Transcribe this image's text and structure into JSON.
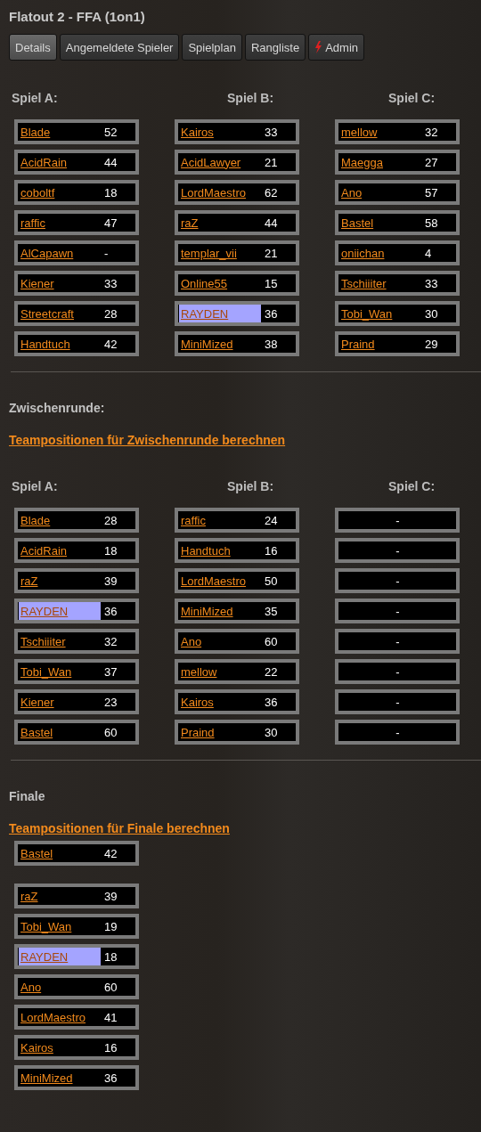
{
  "title": "Flatout 2 - FFA (1on1)",
  "tabs": [
    {
      "label": "Details",
      "selected": true,
      "kind": "plain"
    },
    {
      "label": "Angemeldete Spieler",
      "selected": false,
      "kind": "plain"
    },
    {
      "label": "Spielplan",
      "selected": false,
      "kind": "plain"
    },
    {
      "label": "Rangliste",
      "selected": false,
      "kind": "plain"
    },
    {
      "label": "Admin",
      "selected": false,
      "kind": "admin"
    }
  ],
  "rounds": [
    {
      "games": [
        {
          "heading": "Spiel A:",
          "players": [
            {
              "name": "Blade",
              "score": "52",
              "highlighted": false
            },
            {
              "name": "AcidRain",
              "score": "44",
              "highlighted": false
            },
            {
              "name": "coboltf",
              "score": "18",
              "highlighted": false
            },
            {
              "name": "raffic",
              "score": "47",
              "highlighted": false
            },
            {
              "name": "AlCapawn",
              "score": "-",
              "highlighted": false
            },
            {
              "name": "Kiener",
              "score": "33",
              "highlighted": false
            },
            {
              "name": "Streetcraft",
              "score": "28",
              "highlighted": false
            },
            {
              "name": "Handtuch",
              "score": "42",
              "highlighted": false
            }
          ]
        },
        {
          "heading": "Spiel B:",
          "players": [
            {
              "name": "Kairos",
              "score": "33",
              "highlighted": false
            },
            {
              "name": "AcidLawyer",
              "score": "21",
              "highlighted": false
            },
            {
              "name": "LordMaestro",
              "score": "62",
              "highlighted": false
            },
            {
              "name": "raZ",
              "score": "44",
              "highlighted": false
            },
            {
              "name": "templar_vii",
              "score": "21",
              "highlighted": false
            },
            {
              "name": "Online55",
              "score": "15",
              "highlighted": false
            },
            {
              "name": "RAYDEN",
              "score": "36",
              "highlighted": true
            },
            {
              "name": "MiniMized",
              "score": "38",
              "highlighted": false
            }
          ]
        },
        {
          "heading": "Spiel C:",
          "players": [
            {
              "name": "mellow",
              "score": "32",
              "highlighted": false
            },
            {
              "name": "Maegga",
              "score": "27",
              "highlighted": false
            },
            {
              "name": "Ano",
              "score": "57",
              "highlighted": false
            },
            {
              "name": "Bastel",
              "score": "58",
              "highlighted": false
            },
            {
              "name": "oniichan",
              "score": "4",
              "highlighted": false
            },
            {
              "name": "Tschiiiter",
              "score": "33",
              "highlighted": false
            },
            {
              "name": "Tobi_Wan",
              "score": "30",
              "highlighted": false
            },
            {
              "name": "Praind",
              "score": "29",
              "highlighted": false
            }
          ]
        }
      ]
    },
    {
      "title": "Zwischenrunde:",
      "link": "Teampositionen für Zwischenrunde berechnen",
      "games": [
        {
          "heading": "Spiel A:",
          "players": [
            {
              "name": "Blade",
              "score": "28",
              "highlighted": false
            },
            {
              "name": "AcidRain",
              "score": "18",
              "highlighted": false
            },
            {
              "name": "raZ",
              "score": "39",
              "highlighted": false
            },
            {
              "name": "RAYDEN",
              "score": "36",
              "highlighted": true
            },
            {
              "name": "Tschiiiter",
              "score": "32",
              "highlighted": false
            },
            {
              "name": "Tobi_Wan",
              "score": "37",
              "highlighted": false
            },
            {
              "name": "Kiener",
              "score": "23",
              "highlighted": false
            },
            {
              "name": "Bastel",
              "score": "60",
              "highlighted": false
            }
          ]
        },
        {
          "heading": "Spiel B:",
          "players": [
            {
              "name": "raffic",
              "score": "24",
              "highlighted": false
            },
            {
              "name": "Handtuch",
              "score": "16",
              "highlighted": false
            },
            {
              "name": "LordMaestro",
              "score": "50",
              "highlighted": false
            },
            {
              "name": "MiniMized",
              "score": "35",
              "highlighted": false
            },
            {
              "name": "Ano",
              "score": "60",
              "highlighted": false
            },
            {
              "name": "mellow",
              "score": "22",
              "highlighted": false
            },
            {
              "name": "Kairos",
              "score": "36",
              "highlighted": false
            },
            {
              "name": "Praind",
              "score": "30",
              "highlighted": false
            }
          ]
        },
        {
          "heading": "Spiel C:",
          "players": [
            {
              "score": "-"
            },
            {
              "score": "-"
            },
            {
              "score": "-"
            },
            {
              "score": "-"
            },
            {
              "score": "-"
            },
            {
              "score": "-"
            },
            {
              "score": "-"
            },
            {
              "score": "-"
            }
          ]
        }
      ]
    }
  ],
  "finale": {
    "title": "Finale",
    "link": "Teampositionen für Finale berechnen",
    "winner": {
      "name": "Bastel",
      "score": "42",
      "highlighted": false
    },
    "players": [
      {
        "name": "raZ",
        "score": "39",
        "highlighted": false
      },
      {
        "name": "Tobi_Wan",
        "score": "19",
        "highlighted": false
      },
      {
        "name": "RAYDEN",
        "score": "18",
        "highlighted": true
      },
      {
        "name": "Ano",
        "score": "60",
        "highlighted": false
      },
      {
        "name": "LordMaestro",
        "score": "41",
        "highlighted": false
      },
      {
        "name": "Kairos",
        "score": "16",
        "highlighted": false
      },
      {
        "name": "MiniMized",
        "score": "36",
        "highlighted": false
      }
    ]
  }
}
